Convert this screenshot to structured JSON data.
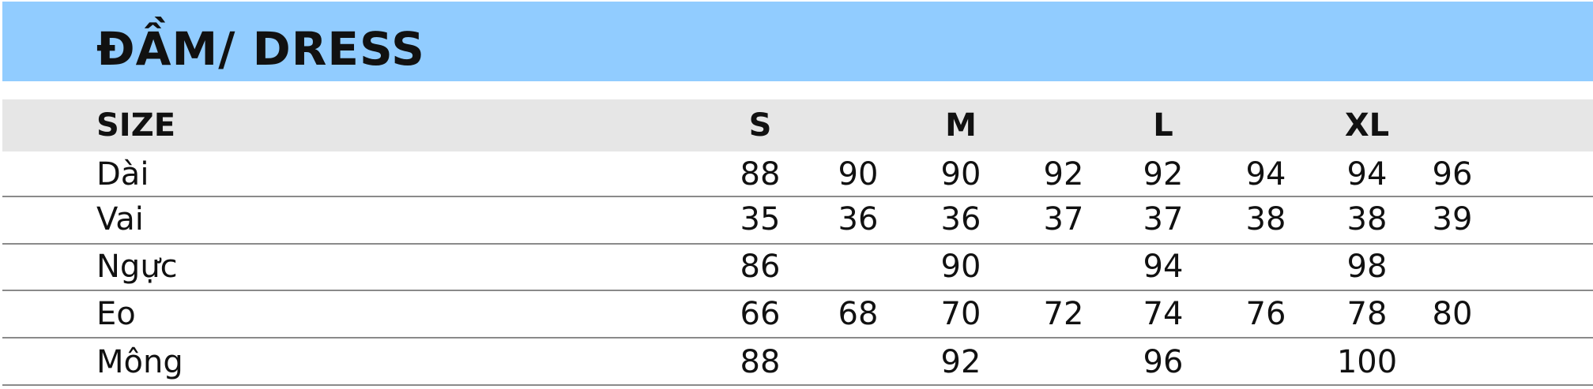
{
  "title": "ĐẦM/ DRESS",
  "colors": {
    "title_band": "#91ccff",
    "header_band": "#e6e6e6",
    "rule": "#8a8a8a"
  },
  "table": {
    "header": {
      "label": "SIZE",
      "sizes": [
        "S",
        "M",
        "L",
        "XL"
      ]
    },
    "rows": [
      {
        "label": "Dài",
        "values": [
          "88",
          "90",
          "90",
          "92",
          "92",
          "94",
          "94",
          "96"
        ]
      },
      {
        "label": "Vai",
        "values": [
          "35",
          "36",
          "36",
          "37",
          "37",
          "38",
          "38",
          "39"
        ]
      },
      {
        "label": "Ngực",
        "values": [
          "86",
          "",
          "90",
          "",
          "94",
          "",
          "98",
          ""
        ]
      },
      {
        "label": "Eo",
        "values": [
          "66",
          "68",
          "70",
          "72",
          "74",
          "76",
          "78",
          "80"
        ]
      },
      {
        "label": "Mông",
        "values": [
          "88",
          "",
          "92",
          "",
          "96",
          "",
          "100",
          ""
        ]
      }
    ]
  }
}
